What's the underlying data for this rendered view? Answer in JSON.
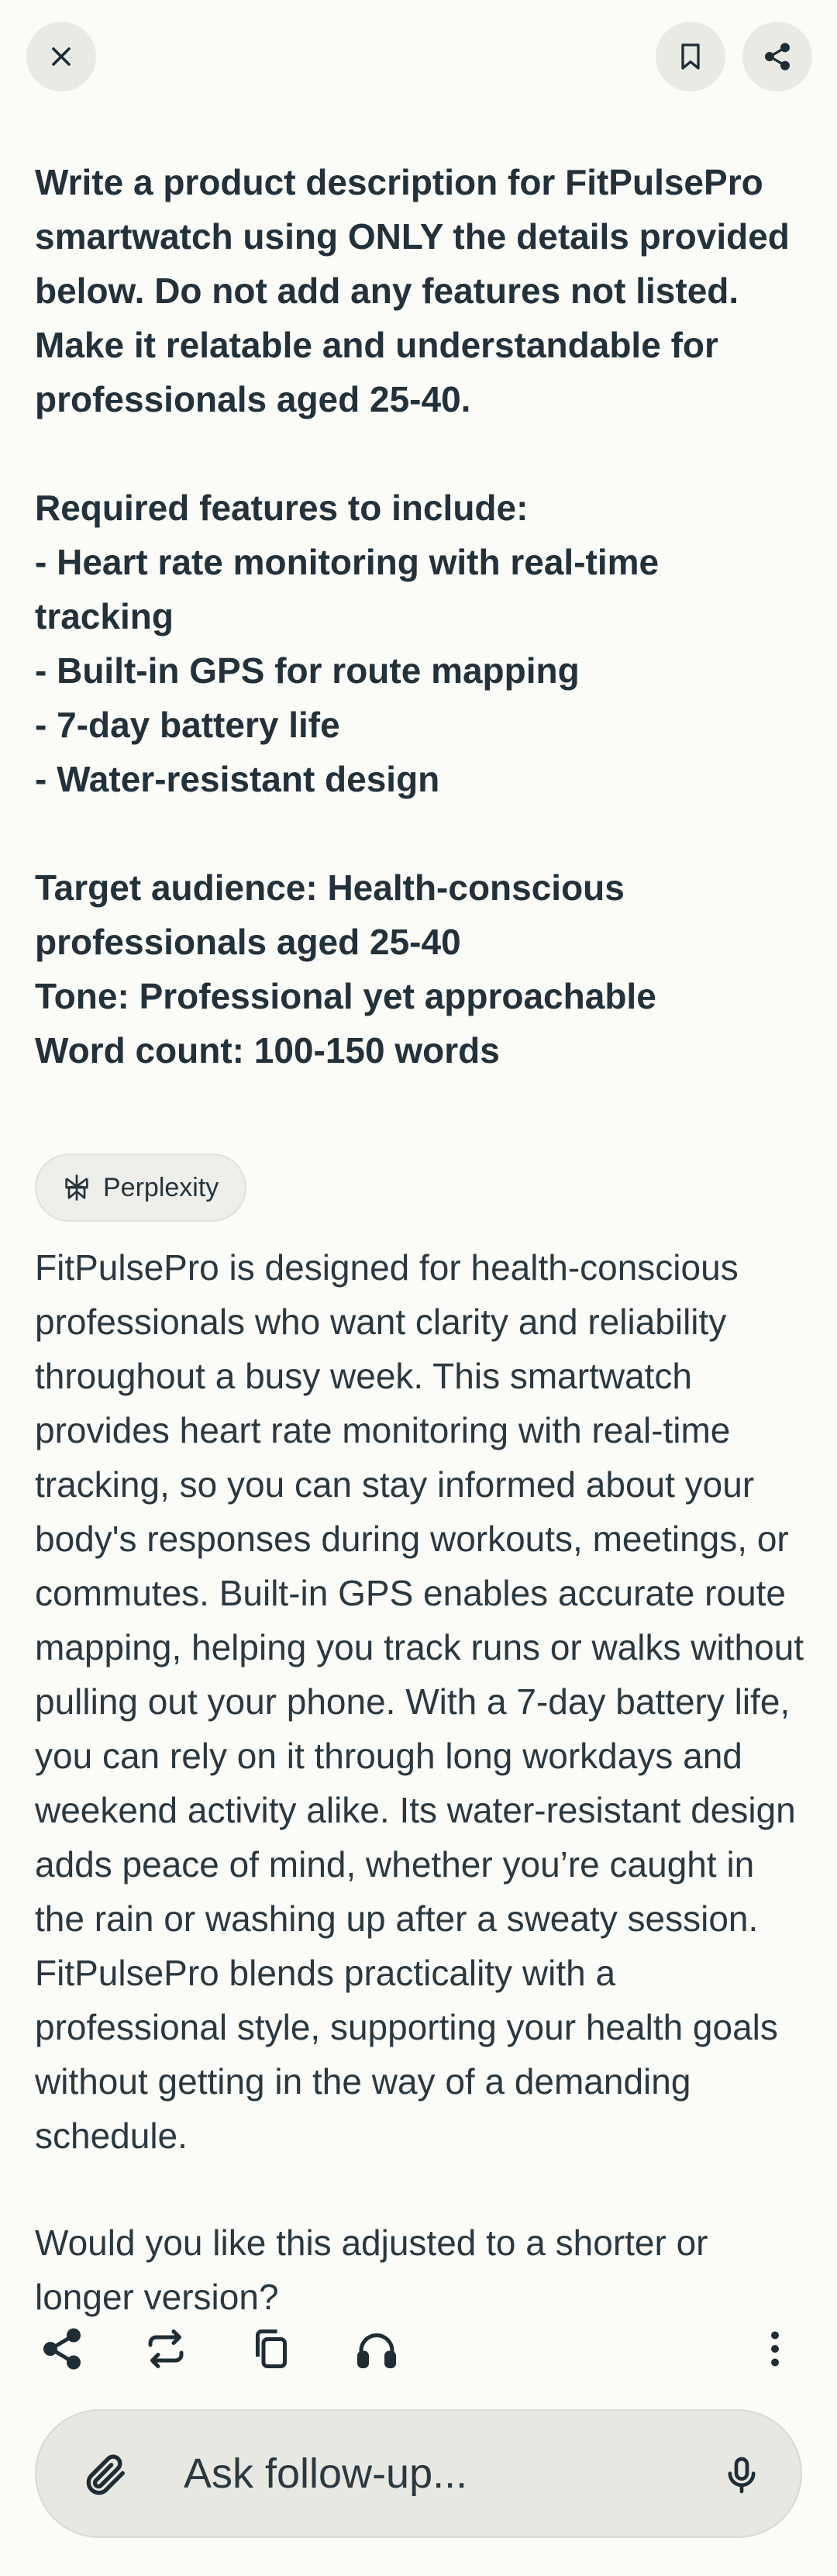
{
  "query": {
    "lines_1": "Write a product description for FitPulsePro smartwatch using ONLY the details provided below. Do not add any features not listed. Make it relatable and understandable for professionals aged 25-40.",
    "required_heading": "Required features to include:",
    "features": [
      "- Heart rate monitoring with real-time tracking",
      "- Built-in GPS for route mapping",
      "- 7-day battery life",
      "- Water-resistant design"
    ],
    "target": "Target audience: Health-conscious professionals aged 25-40",
    "tone": "Tone: Professional yet approachable",
    "word_count": "Word count: 100-150 words"
  },
  "source": {
    "label": "Perplexity",
    "icon": "perplexity-logo-icon"
  },
  "answer": {
    "body": "FitPulsePro is designed for health-conscious professionals who want clarity and reliability throughout a busy week. This smartwatch provides heart rate monitoring with real-time tracking, so you can stay informed about your body's responses during workouts, meetings, or commutes. Built-in GPS enables accurate route mapping, helping you track runs or walks without pulling out your phone. With a 7-day battery life, you can rely on it through long workdays and weekend activity alike. Its water-resistant design adds peace of mind, whether you’re caught in the rain or washing up after a sweaty session. FitPulsePro blends practicality with a professional style, supporting your health goals without getting in the way of a demanding schedule.",
    "follow_up_question": "Would you like this adjusted to a shorter or longer version?"
  },
  "composer": {
    "placeholder": "Ask follow-up..."
  },
  "icons": {
    "close": "close-icon",
    "bookmark": "bookmark-icon",
    "share": "share-icon",
    "rewrite": "rewrite-icon",
    "copy": "copy-icon",
    "listen": "headphones-icon",
    "more": "more-vertical-icon",
    "attach": "paperclip-icon",
    "mic": "microphone-icon"
  }
}
